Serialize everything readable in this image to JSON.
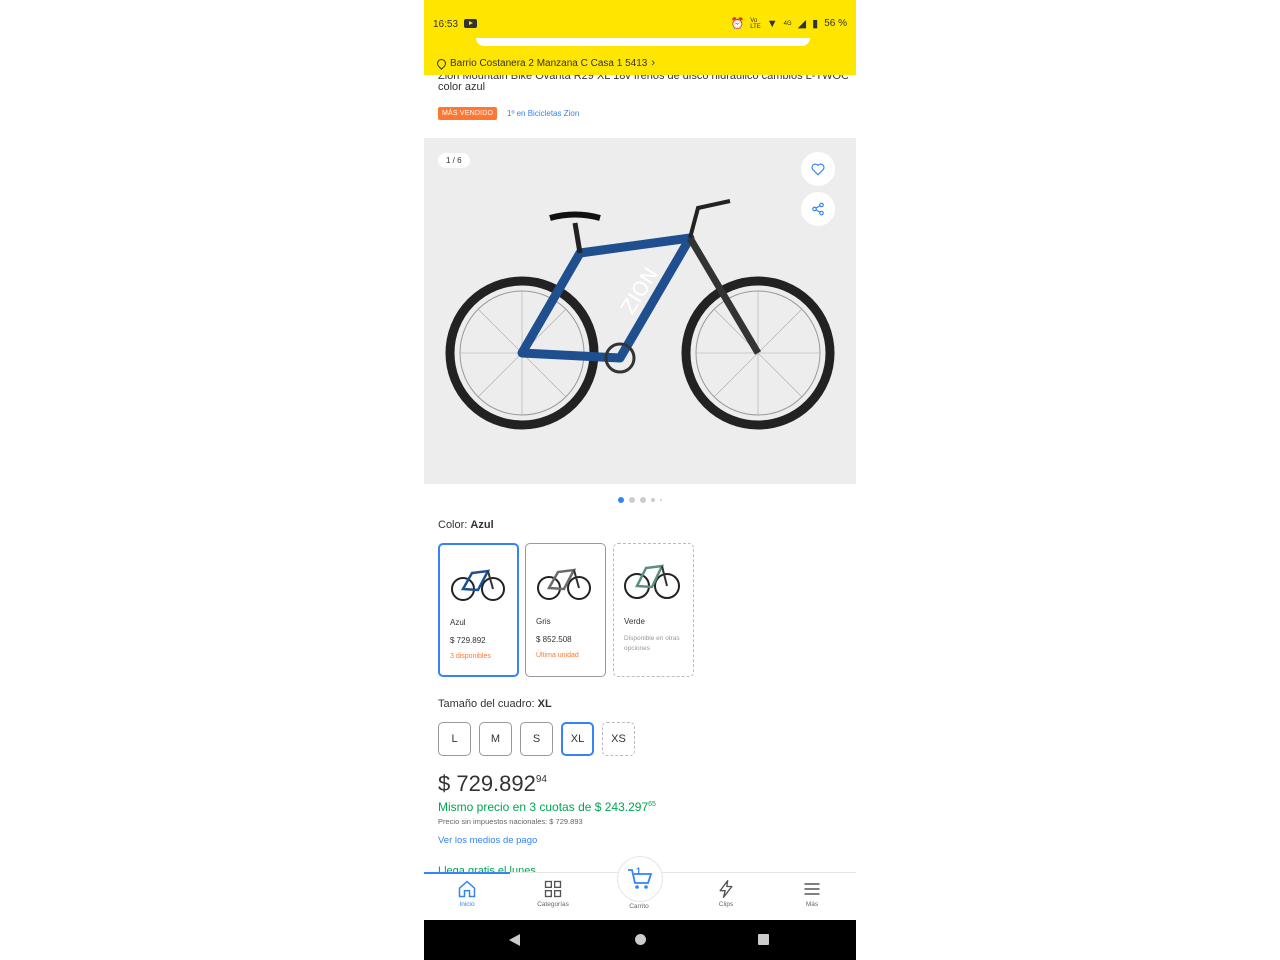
{
  "status_bar": {
    "time": "16:53",
    "battery": "56 %",
    "network": "4G"
  },
  "header": {
    "location": "Barrio Costanera 2 Manzana C Casa 1 5413"
  },
  "product": {
    "title_partial": "Zion Mountain Bike Ovanta R29 XL 18v frenos de disco hidráulico cambios L-TWOO",
    "title_line2": "color azul",
    "badge": "MÁS VENDIDO",
    "rank": "1º en Bicicletas Zion"
  },
  "gallery": {
    "counter": "1 / 6",
    "total_images": 6,
    "current_image": 1
  },
  "colors": {
    "label": "Color: ",
    "selected": "Azul",
    "options": [
      {
        "name": "Azul",
        "price": "$ 729.892",
        "stock": "3 disponibles",
        "color": "#1f4f8f"
      },
      {
        "name": "Gris",
        "price": "$ 852.508",
        "stock": "Última unidad",
        "color": "#6b6b6b"
      },
      {
        "name": "Verde",
        "note": "Disponible en otras opciones",
        "color": "#5a8f7a"
      }
    ]
  },
  "sizes": {
    "label": "Tamaño del cuadro: ",
    "selected": "XL",
    "options": [
      "L",
      "M",
      "S",
      "XL",
      "XS"
    ]
  },
  "price": {
    "main": "$ 729.892",
    "cents": "94",
    "installments_text": "Mismo precio en 3 cuotas de $ 243.297",
    "installments_cents": "65",
    "no_tax": "Precio sin impuestos nacionales: $ 729.893",
    "payment_link": "Ver los medios de pago",
    "shipping_partial": "Llega gratis el lunes"
  },
  "bottom_nav": {
    "items": [
      {
        "label": "Inicio",
        "icon": "home-icon"
      },
      {
        "label": "Categorías",
        "icon": "grid-icon"
      },
      {
        "label": "Carrito",
        "icon": "cart-icon",
        "count": "1"
      },
      {
        "label": "Clips",
        "icon": "clips-icon"
      },
      {
        "label": "Más",
        "icon": "menu-icon"
      }
    ]
  },
  "colors_theme": {
    "brand_yellow": "#ffe600",
    "accent_blue": "#3483fa",
    "green": "#00a650",
    "orange": "#ff7733"
  }
}
